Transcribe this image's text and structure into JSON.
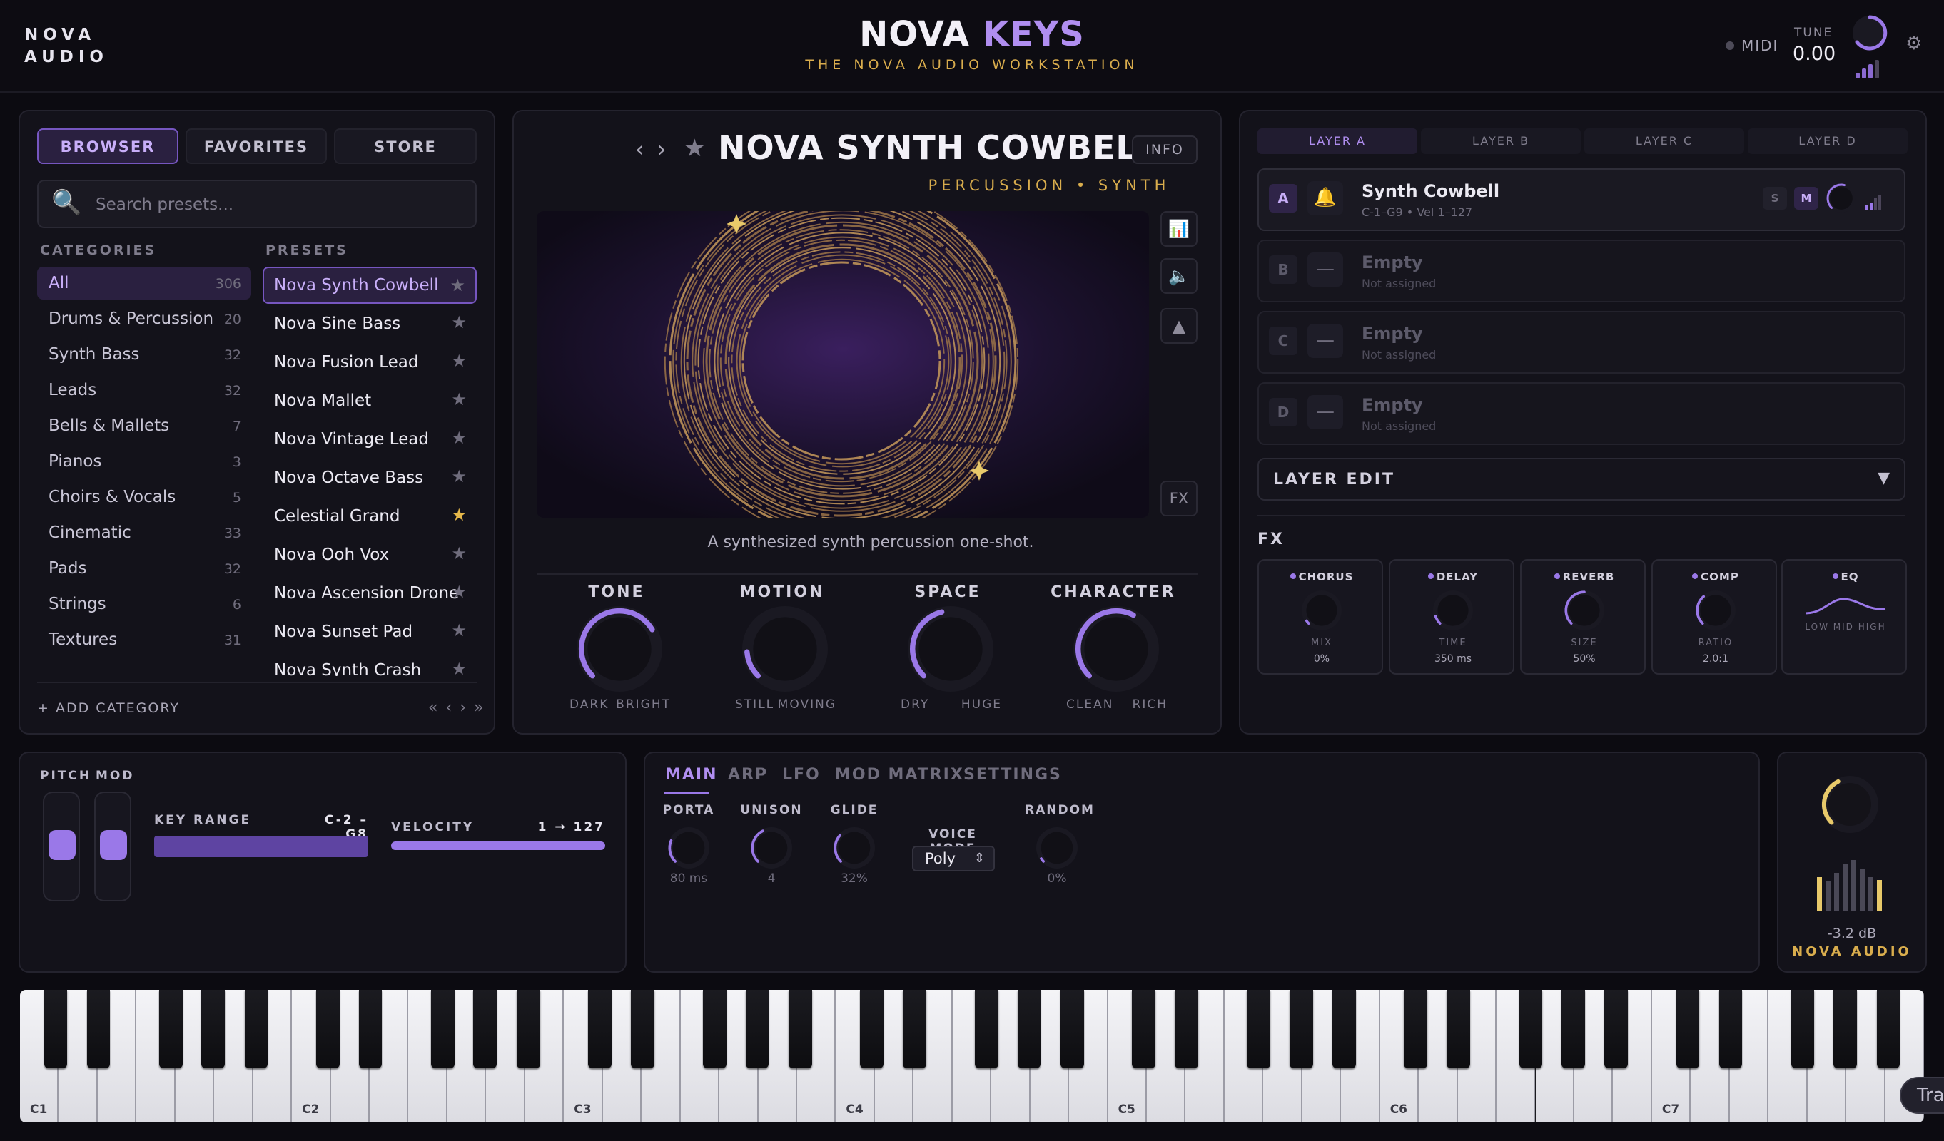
{
  "header": {
    "logo_line1": "NOVA",
    "logo_line2": "AUDIO",
    "title_main": "NOVA",
    "title_accent": "KEYS",
    "subtitle": "THE NOVA AUDIO WORKSTATION",
    "midi_label": "MIDI",
    "tune_label": "TUNE",
    "tune_value": "0.00",
    "settings_icon": "gear-icon"
  },
  "browser": {
    "tabs": [
      "BROWSER",
      "FAVORITES",
      "STORE"
    ],
    "active_tab": "BROWSER",
    "search_placeholder": "Search presets...",
    "categories_header": "CATEGORIES",
    "presets_header": "PRESETS",
    "categories": [
      {
        "name": "All",
        "count": "306"
      },
      {
        "name": "Drums & Percussion",
        "count": "20"
      },
      {
        "name": "Synth Bass",
        "count": "32"
      },
      {
        "name": "Leads",
        "count": "32"
      },
      {
        "name": "Bells & Mallets",
        "count": "7"
      },
      {
        "name": "Pianos",
        "count": "3"
      },
      {
        "name": "Choirs & Vocals",
        "count": "5"
      },
      {
        "name": "Cinematic",
        "count": "33"
      },
      {
        "name": "Pads",
        "count": "32"
      },
      {
        "name": "Strings",
        "count": "6"
      },
      {
        "name": "Textures",
        "count": "31"
      }
    ],
    "presets": [
      {
        "name": "Nova Synth Cowbell",
        "star": "★"
      },
      {
        "name": "Nova Sine Bass",
        "star": "★"
      },
      {
        "name": "Nova Fusion Lead",
        "star": "★"
      },
      {
        "name": "Nova Mallet",
        "star": "★"
      },
      {
        "name": "Nova Vintage Lead",
        "star": "★"
      },
      {
        "name": "Nova Octave Bass",
        "star": "★"
      },
      {
        "name": "Celestial Grand",
        "star": "★"
      },
      {
        "name": "Nova Ooh Vox",
        "star": "★"
      },
      {
        "name": "Nova Ascension Drone",
        "star": "★"
      },
      {
        "name": "Nova Sunset Pad",
        "star": "★"
      },
      {
        "name": "Nova Synth Crash",
        "star": "★"
      }
    ],
    "add_category": "+ ADD CATEGORY",
    "pager": "« ‹ › »"
  },
  "preset": {
    "name": "NOVA SYNTH COWBELL",
    "tags": "PERCUSSION • SYNTH",
    "info_label": "INFO",
    "description": "A synthesized synth percussion one-shot.",
    "fx_label": "FX",
    "side_icons": [
      "chart-icon",
      "speaker-icon",
      "triangle-icon"
    ]
  },
  "macros": [
    {
      "title": "TONE",
      "left": "DARK",
      "right": "BRIGHT",
      "value": 0.72
    },
    {
      "title": "MOTION",
      "left": "STILL",
      "right": "MOVING",
      "value": 0.15
    },
    {
      "title": "SPACE",
      "left": "DRY",
      "right": "HUGE",
      "value": 0.45
    },
    {
      "title": "CHARACTER",
      "left": "CLEAN",
      "right": "RICH",
      "value": 0.6
    }
  ],
  "layers": {
    "tabs": [
      "LAYER A",
      "LAYER B",
      "LAYER C",
      "LAYER D"
    ],
    "items": [
      {
        "badge": "A",
        "icon": "🔔",
        "name": "Synth Cowbell",
        "sub": "C-1–G9 • Vel 1–127"
      },
      {
        "badge": "B",
        "icon": "—",
        "name": "Empty",
        "sub": "Not assigned"
      },
      {
        "badge": "C",
        "icon": "—",
        "name": "Empty",
        "sub": "Not assigned"
      },
      {
        "badge": "D",
        "icon": "—",
        "name": "Empty",
        "sub": "Not assigned"
      }
    ],
    "solo": "S",
    "mute": "M",
    "layer_edit": "LAYER EDIT",
    "layer_edit_arrow": "▼"
  },
  "fx": {
    "header": "FX",
    "modules": [
      {
        "name": "CHORUS",
        "param": "MIX",
        "value": "0%",
        "level": 0.0
      },
      {
        "name": "DELAY",
        "param": "TIME",
        "value": "350 ms",
        "level": 0.1
      },
      {
        "name": "REVERB",
        "param": "SIZE",
        "value": "50%",
        "level": 0.5
      },
      {
        "name": "COMP",
        "param": "RATIO",
        "value": "2.0:1",
        "level": 0.35
      }
    ],
    "eq": {
      "name": "EQ",
      "bands": "LOW  MID  HIGH"
    }
  },
  "performance": {
    "pitch_label": "PITCH",
    "mod_label": "MOD",
    "key_range_label": "KEY RANGE",
    "key_range_value": "C-2 – G8",
    "velocity_label": "VELOCITY",
    "velocity_value": "1 → 127"
  },
  "engine": {
    "tabs": [
      "MAIN",
      "ARP",
      "LFO",
      "MOD MATRIX",
      "SETTINGS"
    ],
    "active_tab": "MAIN",
    "params": [
      {
        "label": "PORTA",
        "value": "80 ms",
        "level": 0.25
      },
      {
        "label": "UNISON",
        "value": "4",
        "level": 0.4
      },
      {
        "label": "GLIDE",
        "value": "32%",
        "level": 0.32
      },
      {
        "label": "RANDOM",
        "value": "0%",
        "level": 0.0
      }
    ],
    "voice_mode_label": "VOICE MODE",
    "voice_mode_value": "Poly",
    "voice_mode_chevron": "⌃⌄"
  },
  "master": {
    "level": "-3.2 dB",
    "brand": "NOVA AUDIO",
    "knob_level": 0.4
  },
  "keyboard": {
    "octave_labels": [
      "C1",
      "C2",
      "C3",
      "C4",
      "C5",
      "C6",
      "C7"
    ],
    "transport_label": "Tra"
  },
  "colors": {
    "accent_purple": "#9a78e8",
    "accent_gold": "#d9ad4d",
    "background": "#0c0b11"
  }
}
